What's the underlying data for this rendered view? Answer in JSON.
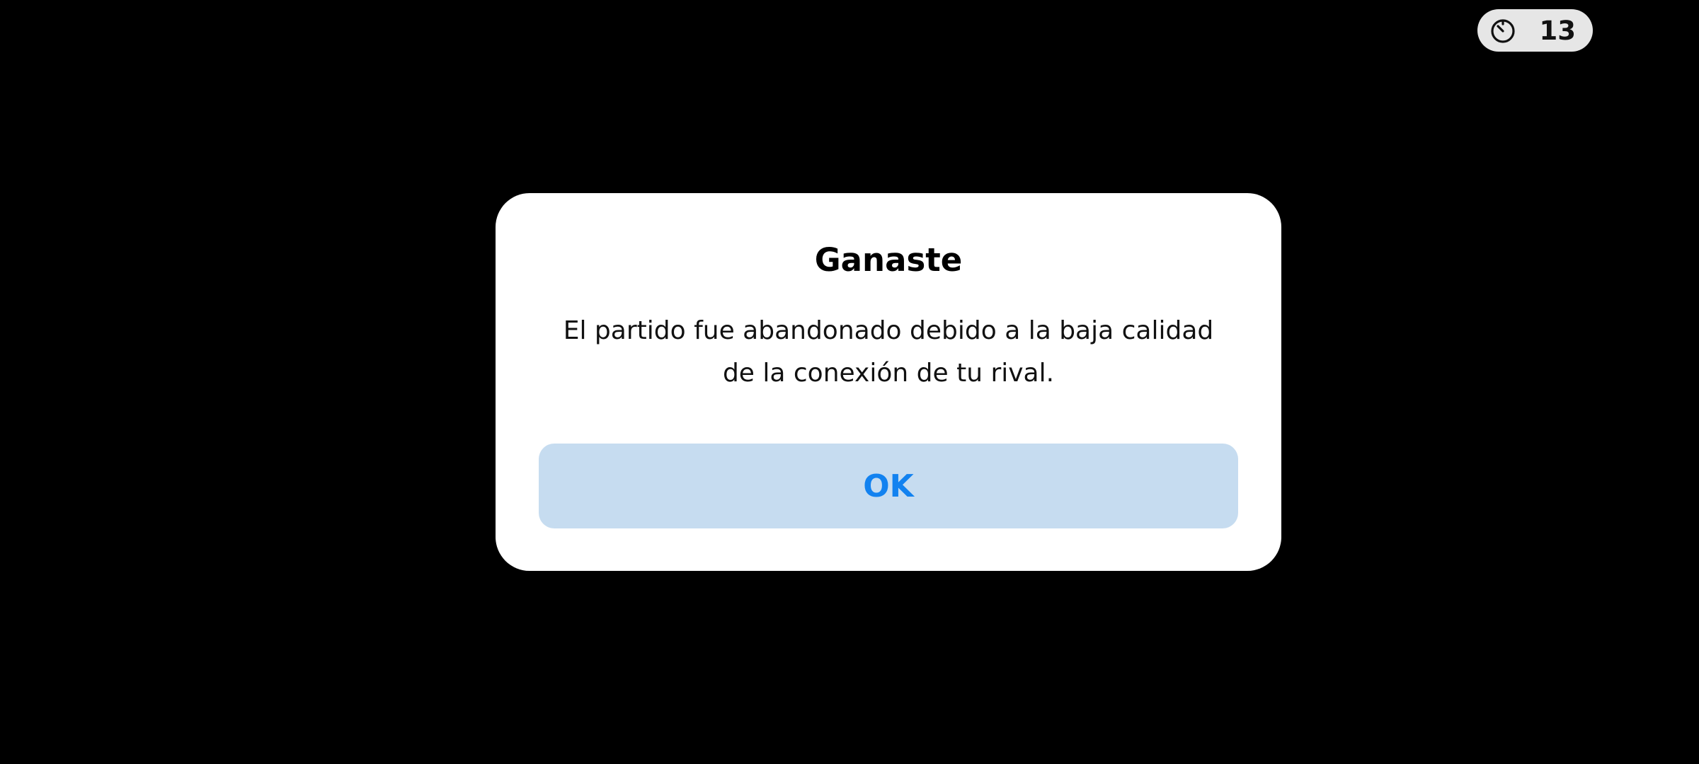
{
  "status": {
    "timer_icon": "timer-icon",
    "timer_value": "13"
  },
  "dialog": {
    "title": "Ganaste",
    "message": "El partido fue abandonado debido a la baja calidad de la conexión de tu rival.",
    "ok_label": "OK"
  },
  "colors": {
    "background": "#000000",
    "dialog_background": "#ffffff",
    "button_background": "#c6dcf0",
    "button_text": "#1282f0",
    "timer_pill": "#e6e6e6"
  }
}
